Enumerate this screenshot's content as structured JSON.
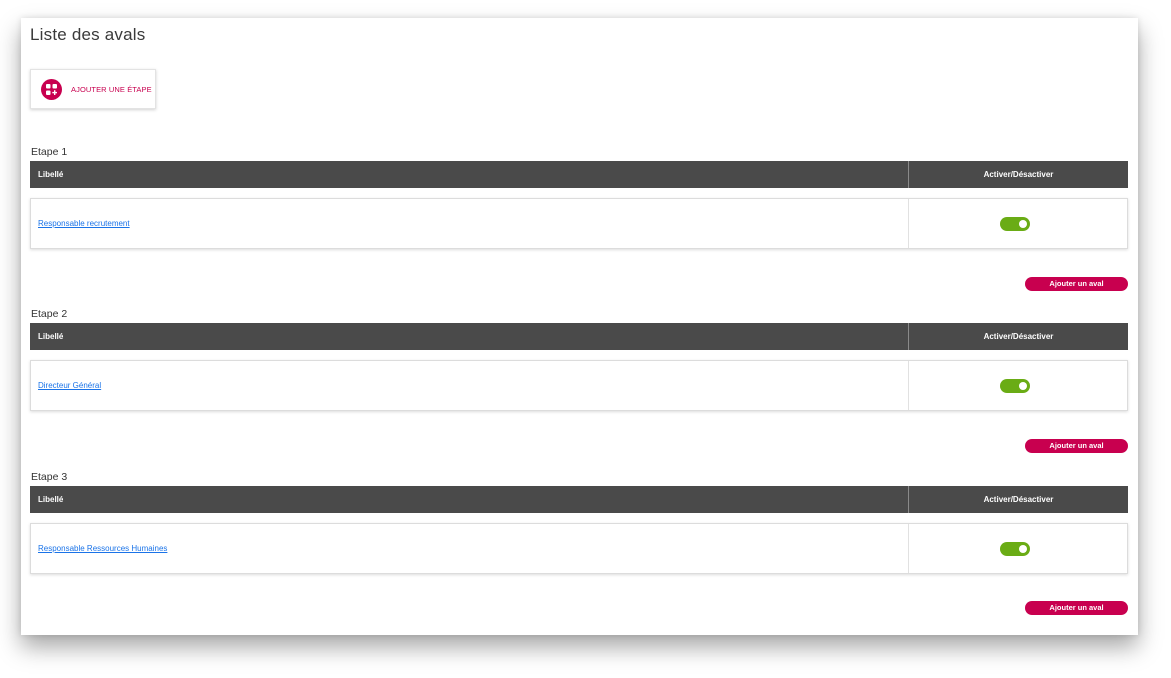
{
  "page": {
    "title": "Liste des avals",
    "add_step_label": "AJOUTER UNE ÉTAPE",
    "add_step_icon": "grid-plus-icon",
    "accent_color": "#c8004f",
    "toggle_on_color": "#6aac15",
    "header_bg": "#4a4a4a"
  },
  "steps": [
    {
      "label": "Etape 1",
      "header": {
        "col_label": "Libellé",
        "col_toggle": "Activer/Désactiver"
      },
      "rows": [
        {
          "label": "Responsable recrutement",
          "active": true
        }
      ],
      "add_button": "Ajouter un aval"
    },
    {
      "label": "Etape 2",
      "header": {
        "col_label": "Libellé",
        "col_toggle": "Activer/Désactiver"
      },
      "rows": [
        {
          "label": "Directeur Général",
          "active": true
        }
      ],
      "add_button": "Ajouter un aval"
    },
    {
      "label": "Etape 3",
      "header": {
        "col_label": "Libellé",
        "col_toggle": "Activer/Désactiver"
      },
      "rows": [
        {
          "label": "Responsable Ressources Humaines",
          "active": true
        }
      ],
      "add_button": "Ajouter un aval"
    }
  ]
}
